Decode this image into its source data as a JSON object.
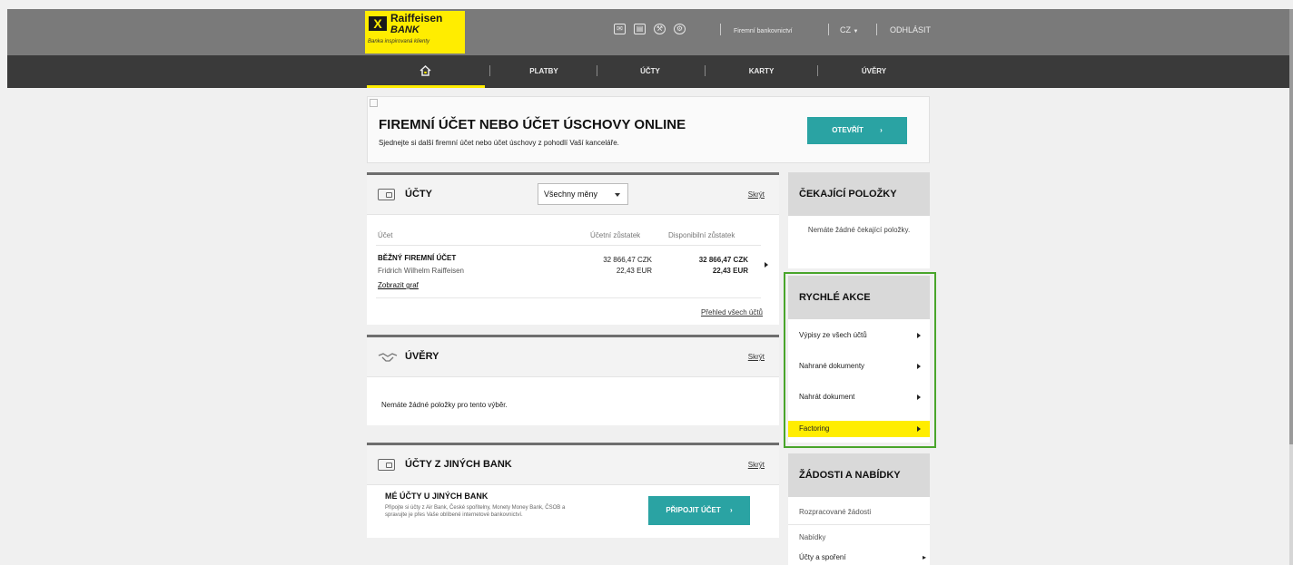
{
  "brand": {
    "mark": "X",
    "name": "Raiffeisen",
    "bank": "BANK",
    "tagline": "Banka inspirovaná klienty",
    "color": "#ffed00"
  },
  "topbar": {
    "icons": [
      "envelope-icon",
      "document-icon",
      "settings-tools-icon",
      "gear-icon"
    ],
    "service": "Firemní bankovnictví",
    "language": "CZ",
    "logout": "ODHLÁSIT"
  },
  "nav": {
    "home_icon": "home-icon",
    "items": [
      "PLATBY",
      "ÚČTY",
      "KARTY",
      "ÚVĚRY"
    ],
    "active_color": "#ffed00"
  },
  "banner": {
    "title": "FIREMNÍ ÚČET NEBO ÚČET ÚSCHOVY ONLINE",
    "subtitle": "Sjednejte si další firemní účet nebo účet úschovy z pohodlí Vaší kanceláře.",
    "button": "OTEVŘÍT",
    "button_color": "#2aa3a3"
  },
  "accounts": {
    "title": "ÚČTY",
    "currency_filter": "Všechny měny",
    "hide": "Skrýt",
    "columns": [
      "Účet",
      "Účetní zůstatek",
      "Disponibilní zůstatek"
    ],
    "rows": [
      {
        "name": "BĚŽNÝ FIREMNÍ ÚČET",
        "owner": "Fridrich Wilhelm Raiffeisen",
        "graph_link": "Zobrazit graf",
        "balance_czk": "32 866,47 CZK",
        "balance_eur": "22,43 EUR",
        "available_czk": "32 866,47 CZK",
        "available_eur": "22,43 EUR"
      }
    ],
    "overview_link": "Přehled všech účtů"
  },
  "loans": {
    "title": "ÚVĚRY",
    "hide": "Skrýt",
    "empty": "Nemáte žádné položky pro tento výběr."
  },
  "other_banks": {
    "title": "ÚČTY Z JINÝCH BANK",
    "hide": "Skrýt",
    "subtitle": "MÉ ÚČTY U JINÝCH BANK",
    "description": "Připojte si účty z Air Bank, České spořitelny, Monety Money Bank, ČSOB a spravujte je přes Vaše oblíbené internetové bankovnictví.",
    "button": "PŘIPOJIT ÚČET"
  },
  "pending": {
    "title": "ČEKAJÍCÍ POLOŽKY",
    "empty": "Nemáte žádné čekající položky."
  },
  "quick_actions": {
    "title": "RYCHLÉ AKCE",
    "items": [
      {
        "label": "Výpisy ze všech účtů"
      },
      {
        "label": "Nahrané dokumenty"
      },
      {
        "label": "Nahrát dokument"
      },
      {
        "label": "Factoring",
        "highlighted": true
      }
    ],
    "highlight_border": "#49a52b"
  },
  "requests": {
    "title": "ŽÁDOSTI A NABÍDKY",
    "items": [
      "Rozpracované žádosti",
      "Nabídky",
      "Účty a spoření"
    ]
  }
}
